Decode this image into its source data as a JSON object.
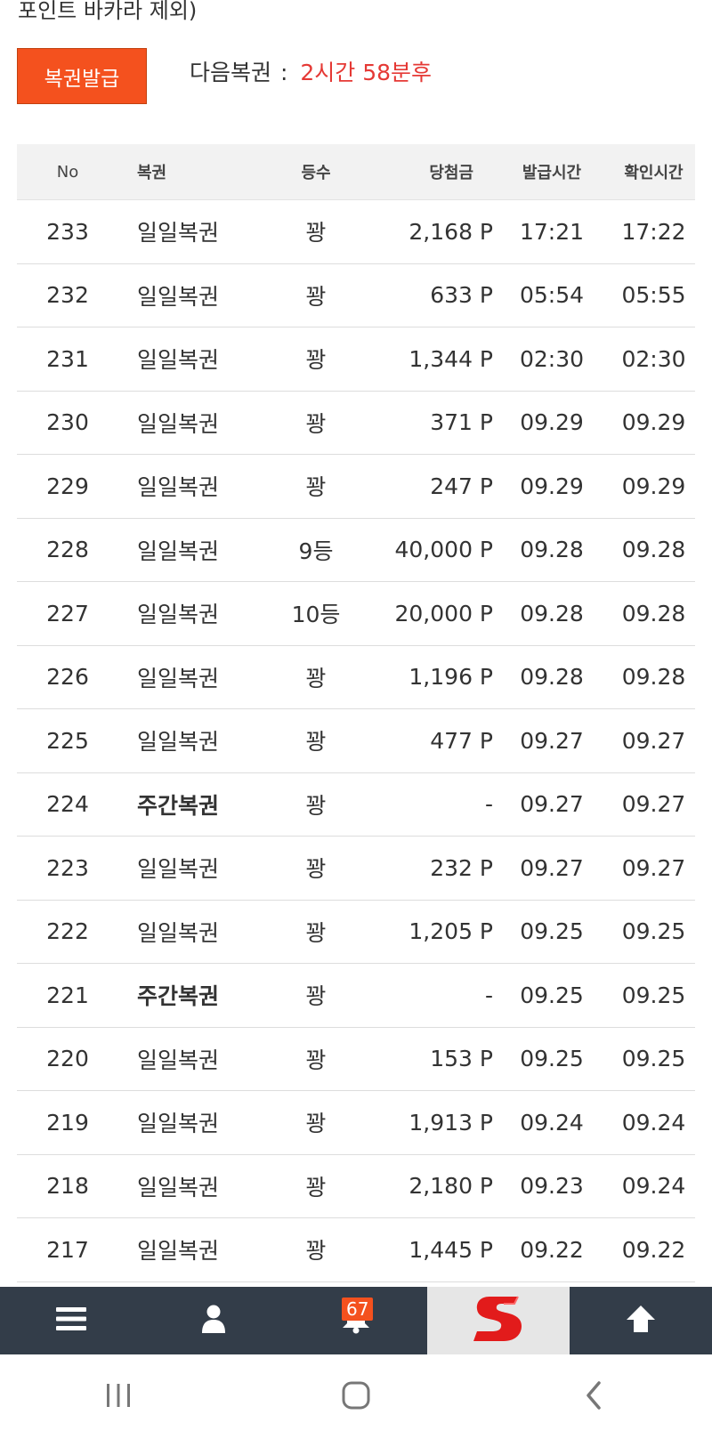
{
  "top_note": "포인트 바카라 제외)",
  "issue_button": "복권발급",
  "next": {
    "label": "다음복권",
    "colon": ":",
    "value": "2시간 58분후"
  },
  "table": {
    "headers": {
      "no": "No",
      "name": "복권",
      "rank": "등수",
      "prize": "당첨금",
      "issued": "발급시간",
      "checked": "확인시간"
    },
    "rows": [
      {
        "no": "233",
        "name": "일일복권",
        "rank": "꽝",
        "prize": "2,168 P",
        "issued": "17:21",
        "checked": "17:22",
        "bold": false
      },
      {
        "no": "232",
        "name": "일일복권",
        "rank": "꽝",
        "prize": "633 P",
        "issued": "05:54",
        "checked": "05:55",
        "bold": false
      },
      {
        "no": "231",
        "name": "일일복권",
        "rank": "꽝",
        "prize": "1,344 P",
        "issued": "02:30",
        "checked": "02:30",
        "bold": false
      },
      {
        "no": "230",
        "name": "일일복권",
        "rank": "꽝",
        "prize": "371 P",
        "issued": "09.29",
        "checked": "09.29",
        "bold": false
      },
      {
        "no": "229",
        "name": "일일복권",
        "rank": "꽝",
        "prize": "247 P",
        "issued": "09.29",
        "checked": "09.29",
        "bold": false
      },
      {
        "no": "228",
        "name": "일일복권",
        "rank": "9등",
        "prize": "40,000 P",
        "issued": "09.28",
        "checked": "09.28",
        "bold": false
      },
      {
        "no": "227",
        "name": "일일복권",
        "rank": "10등",
        "prize": "20,000 P",
        "issued": "09.28",
        "checked": "09.28",
        "bold": false
      },
      {
        "no": "226",
        "name": "일일복권",
        "rank": "꽝",
        "prize": "1,196 P",
        "issued": "09.28",
        "checked": "09.28",
        "bold": false
      },
      {
        "no": "225",
        "name": "일일복권",
        "rank": "꽝",
        "prize": "477 P",
        "issued": "09.27",
        "checked": "09.27",
        "bold": false
      },
      {
        "no": "224",
        "name": "주간복권",
        "rank": "꽝",
        "prize": "-",
        "issued": "09.27",
        "checked": "09.27",
        "bold": true
      },
      {
        "no": "223",
        "name": "일일복권",
        "rank": "꽝",
        "prize": "232 P",
        "issued": "09.27",
        "checked": "09.27",
        "bold": false
      },
      {
        "no": "222",
        "name": "일일복권",
        "rank": "꽝",
        "prize": "1,205 P",
        "issued": "09.25",
        "checked": "09.25",
        "bold": false
      },
      {
        "no": "221",
        "name": "주간복권",
        "rank": "꽝",
        "prize": "-",
        "issued": "09.25",
        "checked": "09.25",
        "bold": true
      },
      {
        "no": "220",
        "name": "일일복권",
        "rank": "꽝",
        "prize": "153 P",
        "issued": "09.25",
        "checked": "09.25",
        "bold": false
      },
      {
        "no": "219",
        "name": "일일복권",
        "rank": "꽝",
        "prize": "1,913 P",
        "issued": "09.24",
        "checked": "09.24",
        "bold": false
      },
      {
        "no": "218",
        "name": "일일복권",
        "rank": "꽝",
        "prize": "2,180 P",
        "issued": "09.23",
        "checked": "09.24",
        "bold": false
      },
      {
        "no": "217",
        "name": "일일복권",
        "rank": "꽝",
        "prize": "1,445 P",
        "issued": "09.22",
        "checked": "09.22",
        "bold": false
      }
    ]
  },
  "bottom_bar": {
    "items": [
      {
        "icon": "menu-icon"
      },
      {
        "icon": "user-icon"
      },
      {
        "icon": "bell-icon",
        "badge": "67"
      },
      {
        "icon": "site-logo"
      },
      {
        "icon": "arrow-up-icon"
      }
    ]
  },
  "colors": {
    "accent": "#f4511e",
    "countdown": "#e53935",
    "bar": "#333d49",
    "header_bg": "#f2f2f2"
  }
}
